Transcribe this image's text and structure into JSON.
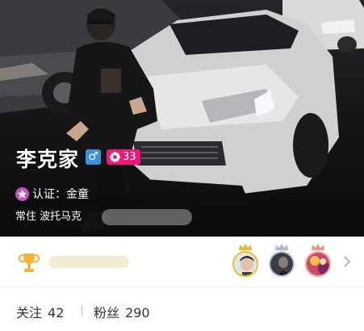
{
  "profile": {
    "name": "李克家",
    "gender_icon": "male-symbol",
    "level": "33",
    "verify_label": "认证：金童",
    "residence": "常住 波托马克"
  },
  "honor": {
    "trophy_icon": "trophy-icon",
    "chevron_icon": "chevron-right-icon"
  },
  "stats": {
    "following_label": "关注",
    "following_count": "42",
    "fans_label": "粉丝",
    "fans_count": "290"
  },
  "colors": {
    "level_badge": "#f0167a",
    "gender_badge": "#3f8fe0",
    "verify_badge": "#c94fbf"
  }
}
